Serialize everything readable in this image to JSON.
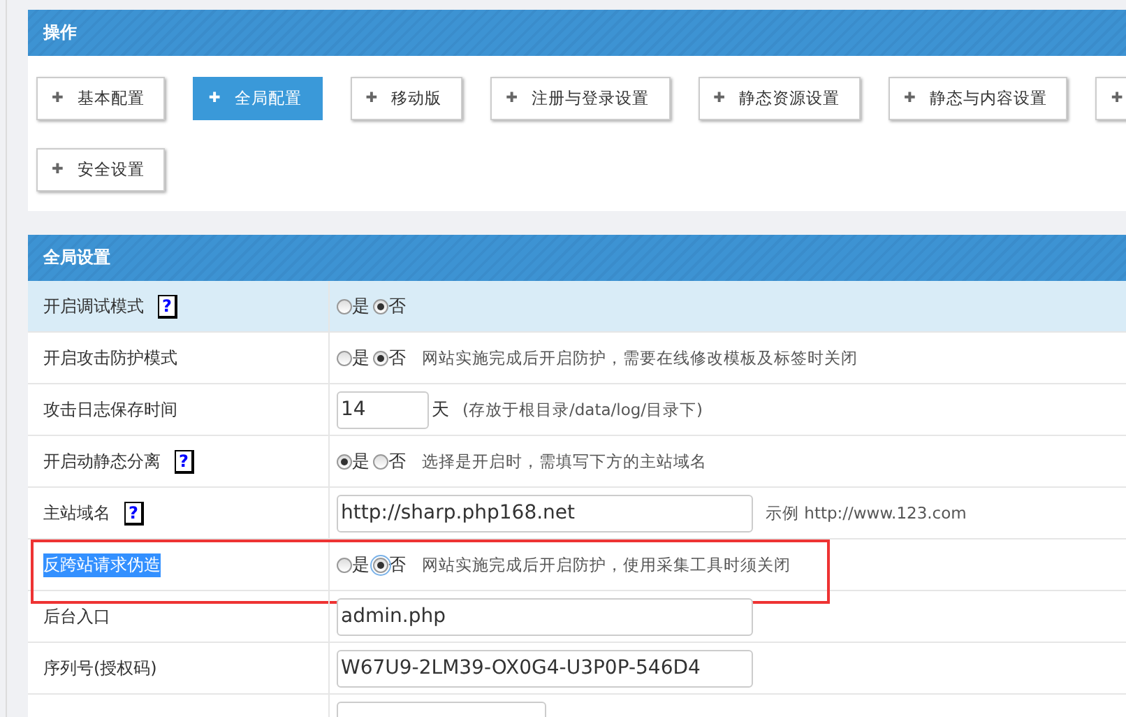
{
  "ops_panel": {
    "title": "操作",
    "button_rows": [
      [
        {
          "label": "基本配置",
          "selected": false
        },
        {
          "label": "全局配置",
          "selected": true
        },
        {
          "label": "移动版",
          "selected": false
        },
        {
          "label": "注册与登录设置",
          "selected": false
        },
        {
          "label": "静态资源设置",
          "selected": false
        },
        {
          "label": "静态与内容设置",
          "selected": false
        },
        {
          "selected": false
        }
      ],
      [
        {
          "label": "安全设置",
          "selected": false
        }
      ]
    ],
    "plus": "✚"
  },
  "settings_panel": {
    "title": "全局设置",
    "rows": [
      {
        "label": "开启调试模式",
        "help": "?",
        "kind": "radio",
        "hovered": true,
        "options": [
          {
            "label": "是",
            "selected": false
          },
          {
            "label": "否",
            "selected": true
          }
        ]
      },
      {
        "label": "开启攻击防护模式",
        "kind": "radio",
        "hovered": false,
        "options": [
          {
            "label": "是",
            "selected": false
          },
          {
            "label": "否",
            "selected": true
          }
        ],
        "note": "网站实施完成后开启防护，需要在线修改模板及标签时关闭"
      },
      {
        "label": "攻击日志保存时间",
        "kind": "input",
        "value": "14",
        "suffix": "天",
        "note": "(存放于根目录/data/log/目录下)"
      },
      {
        "label": "开启动静态分离",
        "help": "?",
        "kind": "radio",
        "options": [
          {
            "label": "是",
            "selected": true
          },
          {
            "label": "否",
            "selected": false
          }
        ],
        "note": "选择是开启时，需填写下方的主站域名"
      },
      {
        "label": "主站域名",
        "help": "?",
        "kind": "input",
        "value": "http://sharp.php168.net",
        "note": "示例 http://www.123.com"
      },
      {
        "label": "反跨站请求伪造",
        "kind": "radio",
        "text_selected": true,
        "marked": true,
        "options": [
          {
            "label": "是",
            "selected": false
          },
          {
            "label": "否",
            "selected": true,
            "focused": true
          }
        ],
        "note": "网站实施完成后开启防护，使用采集工具时须关闭"
      },
      {
        "label": "后台入口",
        "kind": "input",
        "value": "admin.php"
      },
      {
        "label": "序列号(授权码)",
        "kind": "input",
        "value": "W67U9-2LM39-OX0G4-U3P0P-546D4"
      },
      {
        "kind": "input",
        "value": ""
      }
    ]
  }
}
